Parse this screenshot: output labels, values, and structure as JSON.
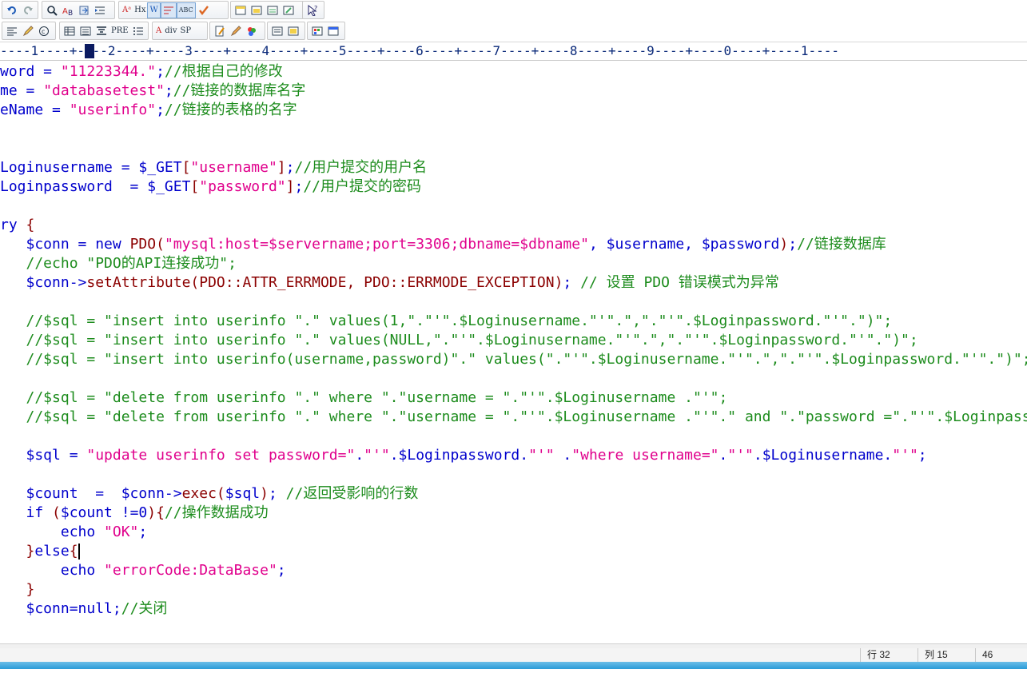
{
  "toolbar_row1": [
    {
      "icon": "undo-icon"
    },
    {
      "icon": "redo-icon"
    },
    {
      "icon": "find-icon"
    },
    {
      "icon": "replace-icon"
    },
    {
      "icon": "goto-icon"
    },
    {
      "icon": "indent-icon"
    },
    {
      "icon": "font-a-icon",
      "label": "Aᵃ"
    },
    {
      "icon": "hex-icon",
      "label": "Hx"
    },
    {
      "icon": "word-wrap-icon",
      "label": "W"
    },
    {
      "icon": "line-wrap-icon"
    },
    {
      "icon": "spell-abc-icon",
      "label": "ABC"
    },
    {
      "icon": "check-icon"
    },
    {
      "icon": "window-icon"
    },
    {
      "icon": "window-split-icon"
    },
    {
      "icon": "window-tile-icon"
    },
    {
      "icon": "window-cascade-icon"
    },
    {
      "icon": "help-pointer-icon"
    }
  ],
  "toolbar_row2": [
    {
      "icon": "align-left-icon"
    },
    {
      "icon": "pen-icon"
    },
    {
      "icon": "copyright-icon"
    },
    {
      "icon": "table-icon"
    },
    {
      "icon": "list-icon"
    },
    {
      "icon": "heading-icon"
    },
    {
      "icon": "pre-icon",
      "label": "PRE"
    },
    {
      "icon": "bullet-list-icon"
    },
    {
      "icon": "font-red-icon",
      "label": "A"
    },
    {
      "icon": "div-icon",
      "label": "div"
    },
    {
      "icon": "span-icon",
      "label": "SP"
    },
    {
      "icon": "edit-doc-icon"
    },
    {
      "icon": "edit-pencil-icon"
    },
    {
      "icon": "colors-icon"
    },
    {
      "icon": "form-icon"
    },
    {
      "icon": "image-icon"
    },
    {
      "icon": "browser-color-icon"
    },
    {
      "icon": "browser-preview-icon"
    }
  ],
  "ruler": "----1----+----2----+----3----+----4----+----5----+----6----+----7----+----8----+----9----+----0----+----1----",
  "code_lines": [
    [
      [
        "var",
        "word = "
      ],
      [
        "str",
        "\"11223344.\""
      ],
      [
        "var",
        ";"
      ],
      [
        "cmt",
        "//根据自己的修改"
      ]
    ],
    [
      [
        "var",
        "me = "
      ],
      [
        "str",
        "\"databasetest\""
      ],
      [
        "var",
        ";"
      ],
      [
        "cmt",
        "//链接的数据库名字"
      ]
    ],
    [
      [
        "var",
        "eName = "
      ],
      [
        "str",
        "\"userinfo\""
      ],
      [
        "var",
        ";"
      ],
      [
        "cmt",
        "//链接的表格的名字"
      ]
    ],
    [],
    [],
    [
      [
        "var",
        "Loginusername = $_GET"
      ],
      [
        "op",
        "["
      ],
      [
        "str",
        "\"username\""
      ],
      [
        "op",
        "]"
      ],
      [
        "var",
        ";"
      ],
      [
        "cmt",
        "//用户提交的用户名"
      ]
    ],
    [
      [
        "var",
        "Loginpassword  = $_GET"
      ],
      [
        "op",
        "["
      ],
      [
        "str",
        "\"password\""
      ],
      [
        "op",
        "]"
      ],
      [
        "var",
        ";"
      ],
      [
        "cmt",
        "//用户提交的密码"
      ]
    ],
    [],
    [
      [
        "kw",
        "ry "
      ],
      [
        "op",
        "{"
      ]
    ],
    [
      [
        "var",
        "   $conn = "
      ],
      [
        "kw",
        "new "
      ],
      [
        "fn",
        "PDO("
      ],
      [
        "str",
        "\"mysql:host=$servername;port=3306;dbname=$dbname\""
      ],
      [
        "var",
        ", $username, $password"
      ],
      [
        "fn",
        ")"
      ],
      [
        "var",
        ";"
      ],
      [
        "cmt",
        "//链接数据库"
      ]
    ],
    [
      [
        "cmt",
        "   //echo \"PDO的API连接成功\";"
      ]
    ],
    [
      [
        "var",
        "   $conn->"
      ],
      [
        "fn",
        "setAttribute(PDO::ATTR_ERRMODE, PDO::ERRMODE_EXCEPTION)"
      ],
      [
        "var",
        "; "
      ],
      [
        "cmt",
        "// 设置 PDO 错误模式为异常"
      ]
    ],
    [],
    [
      [
        "cmt",
        "   //$sql = \"insert into userinfo \".\" values(1,\".\"'\".$Loginusername.\"'\".\",\".\"'\".$Loginpassword.\"'\".\")\";"
      ]
    ],
    [
      [
        "cmt",
        "   //$sql = \"insert into userinfo \".\" values(NULL,\".\"'\".$Loginusername.\"'\".\",\".\"'\".$Loginpassword.\"'\".\")\";"
      ]
    ],
    [
      [
        "cmt",
        "   //$sql = \"insert into userinfo(username,password)\".\" values(\".\"'\".$Loginusername.\"'\".\",\".\"'\".$Loginpassword.\"'\".\")\";"
      ]
    ],
    [],
    [
      [
        "cmt",
        "   //$sql = \"delete from userinfo \".\" where \".\"username = \".\"'\".$Loginusername .\"'\";"
      ]
    ],
    [
      [
        "cmt",
        "   //$sql = \"delete from userinfo \".\" where \".\"username = \".\"'\".$Loginusername .\"'\".\" and \".\"password =\".\"'\".$Loginpassword.\"'\";"
      ]
    ],
    [],
    [
      [
        "var",
        "   $sql = "
      ],
      [
        "str",
        "\"update userinfo set password=\""
      ],
      [
        "var",
        "."
      ],
      [
        "str",
        "\"'\""
      ],
      [
        "var",
        ".$Loginpassword."
      ],
      [
        "str",
        "\"'\""
      ],
      [
        "var",
        " ."
      ],
      [
        "str",
        "\"where username=\""
      ],
      [
        "var",
        "."
      ],
      [
        "str",
        "\"'\""
      ],
      [
        "var",
        ".$Loginusername."
      ],
      [
        "str",
        "\"'\""
      ],
      [
        "var",
        ";"
      ]
    ],
    [],
    [
      [
        "var",
        "   $count  =  $conn->"
      ],
      [
        "fn",
        "exec("
      ],
      [
        "var",
        "$sql"
      ],
      [
        "fn",
        ")"
      ],
      [
        "var",
        "; "
      ],
      [
        "cmt",
        "//返回受影响的行数"
      ]
    ],
    [
      [
        "kw",
        "   if "
      ],
      [
        "op",
        "("
      ],
      [
        "var",
        "$count !=0"
      ],
      [
        "op",
        ")"
      ],
      [
        "op",
        "{"
      ],
      [
        "cmt",
        "//操作数据成功"
      ]
    ],
    [
      [
        "kw",
        "       echo "
      ],
      [
        "str",
        "\"OK\""
      ],
      [
        "var",
        ";"
      ]
    ],
    [
      [
        "op",
        "   }"
      ],
      [
        "kw",
        "else"
      ],
      [
        "op",
        "{"
      ],
      [
        "cursor",
        ""
      ]
    ],
    [
      [
        "kw",
        "       echo "
      ],
      [
        "str",
        "\"errorCode:DataBase\""
      ],
      [
        "var",
        ";"
      ]
    ],
    [
      [
        "op",
        "   }"
      ]
    ],
    [
      [
        "var",
        "   $conn="
      ],
      [
        "kw",
        "null"
      ],
      [
        "var",
        ";"
      ],
      [
        "cmt",
        "//关闭"
      ]
    ]
  ],
  "status": {
    "line": "行 32",
    "col": "列 15",
    "count": "46"
  }
}
